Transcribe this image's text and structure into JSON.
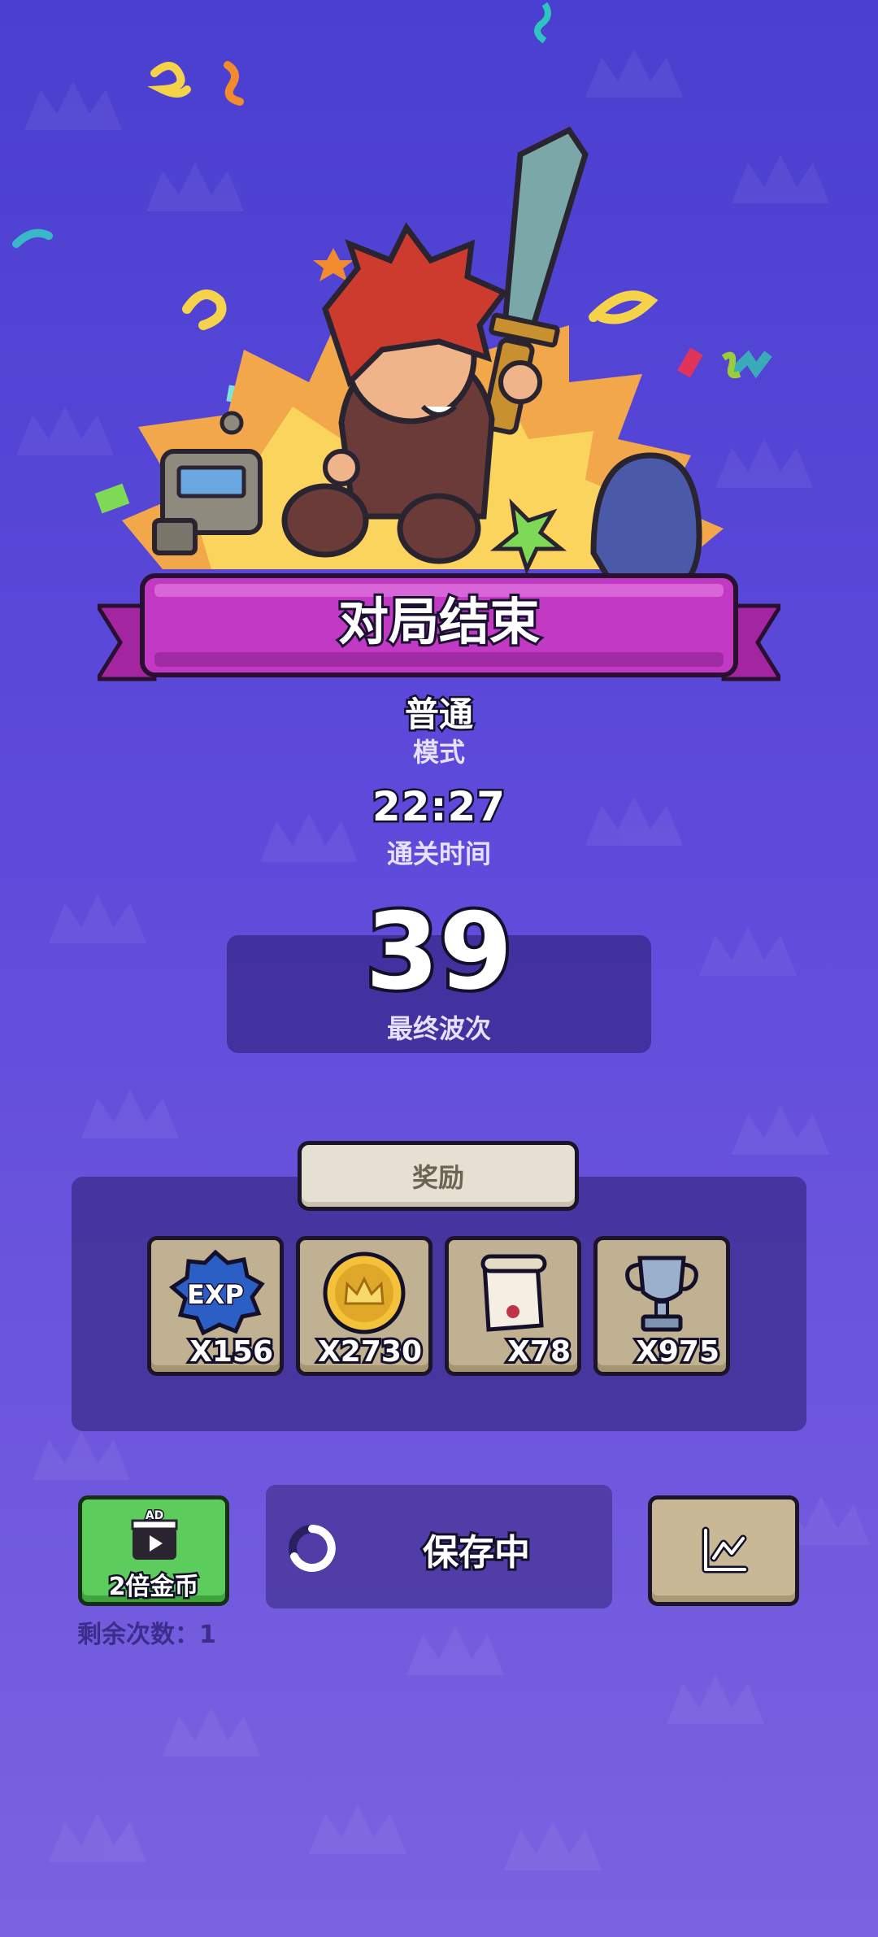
{
  "result": {
    "title": "对局结束",
    "mode_value": "普通",
    "mode_label": "模式",
    "clear_time": "22:27",
    "clear_time_label": "通关时间",
    "final_wave": "39",
    "final_wave_label": "最终波次"
  },
  "rewards": {
    "tab_label": "奖励",
    "items": [
      {
        "icon": "exp-badge-icon",
        "count": "X156"
      },
      {
        "icon": "gold-coin-icon",
        "count": "X2730"
      },
      {
        "icon": "scroll-icon",
        "count": "X78"
      },
      {
        "icon": "trophy-icon",
        "count": "X975"
      }
    ]
  },
  "actions": {
    "ad_badge": "AD",
    "double_gold_label": "2倍金币",
    "remaining_label": "剩余次数：1",
    "saving_label": "保存中",
    "stats_icon": "stats-chart-icon"
  },
  "colors": {
    "banner": "#c23ac4",
    "ad_button": "#5ccd5c",
    "background_top": "#4a3fd0",
    "background_bottom": "#7b62e0"
  }
}
